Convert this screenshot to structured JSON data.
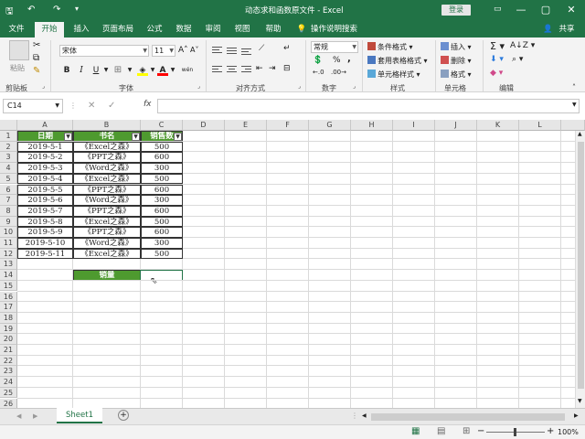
{
  "window": {
    "title": "动态求和函数原文件  -  Excel",
    "login_label": "登录",
    "share_label": "共享",
    "tell_me": "操作说明搜索",
    "minimize": "—",
    "restore": "▢",
    "close": "✕"
  },
  "tabs": [
    "文件",
    "开始",
    "插入",
    "页面布局",
    "公式",
    "数据",
    "审阅",
    "视图",
    "帮助"
  ],
  "active_tab": "开始",
  "ribbon": {
    "clipboard": {
      "paste": "粘贴",
      "group": "剪贴板"
    },
    "font": {
      "name": "宋体",
      "size": "11",
      "grow": "A˄",
      "shrink": "A˅",
      "bold": "B",
      "italic": "I",
      "underline": "U",
      "phonetic": "wén",
      "group": "字体"
    },
    "alignment": {
      "group": "对齐方式"
    },
    "number": {
      "format": "常规",
      "percent": "%",
      "comma": ",",
      "group": "数字"
    },
    "styles": {
      "conditional": "条件格式",
      "table": "套用表格格式",
      "cell": "单元格样式",
      "group": "样式"
    },
    "cells": {
      "insert": "插入",
      "delete": "删除",
      "format": "格式",
      "group": "单元格"
    },
    "editing": {
      "group": "编辑"
    }
  },
  "formula_bar": {
    "name_box": "C14",
    "fx": "fx",
    "formula": ""
  },
  "columns": [
    "A",
    "B",
    "C",
    "D",
    "E",
    "F",
    "G",
    "H",
    "I",
    "J",
    "K",
    "L"
  ],
  "rows": [
    "1",
    "2",
    "3",
    "4",
    "5",
    "6",
    "7",
    "8",
    "9",
    "10",
    "11",
    "12",
    "13",
    "14",
    "15",
    "16",
    "17",
    "18",
    "19",
    "20",
    "21",
    "22",
    "23",
    "24",
    "25",
    "26"
  ],
  "table": {
    "headers": [
      "日期",
      "书名",
      "销售数"
    ],
    "rows": [
      [
        "2019-5-1",
        "《Excel之森》",
        "500"
      ],
      [
        "2019-5-2",
        "《PPT之森》",
        "600"
      ],
      [
        "2019-5-3",
        "《Word之森》",
        "300"
      ],
      [
        "2019-5-4",
        "《Excel之森》",
        "500"
      ],
      [
        "2019-5-5",
        "《PPT之森》",
        "600"
      ],
      [
        "2019-5-6",
        "《Word之森》",
        "300"
      ],
      [
        "2019-5-7",
        "《PPT之森》",
        "600"
      ],
      [
        "2019-5-8",
        "《Excel之森》",
        "500"
      ],
      [
        "2019-5-9",
        "《PPT之森》",
        "600"
      ],
      [
        "2019-5-10",
        "《Word之森》",
        "300"
      ],
      [
        "2019-5-11",
        "《Excel之森》",
        "500"
      ]
    ]
  },
  "summary": {
    "label": "销量",
    "value": ""
  },
  "sheet": {
    "name": "Sheet1",
    "add": "+"
  },
  "status": {
    "zoom": "100%"
  },
  "colors": {
    "excel_green": "#217346",
    "header_green": "#4e9a2f"
  }
}
